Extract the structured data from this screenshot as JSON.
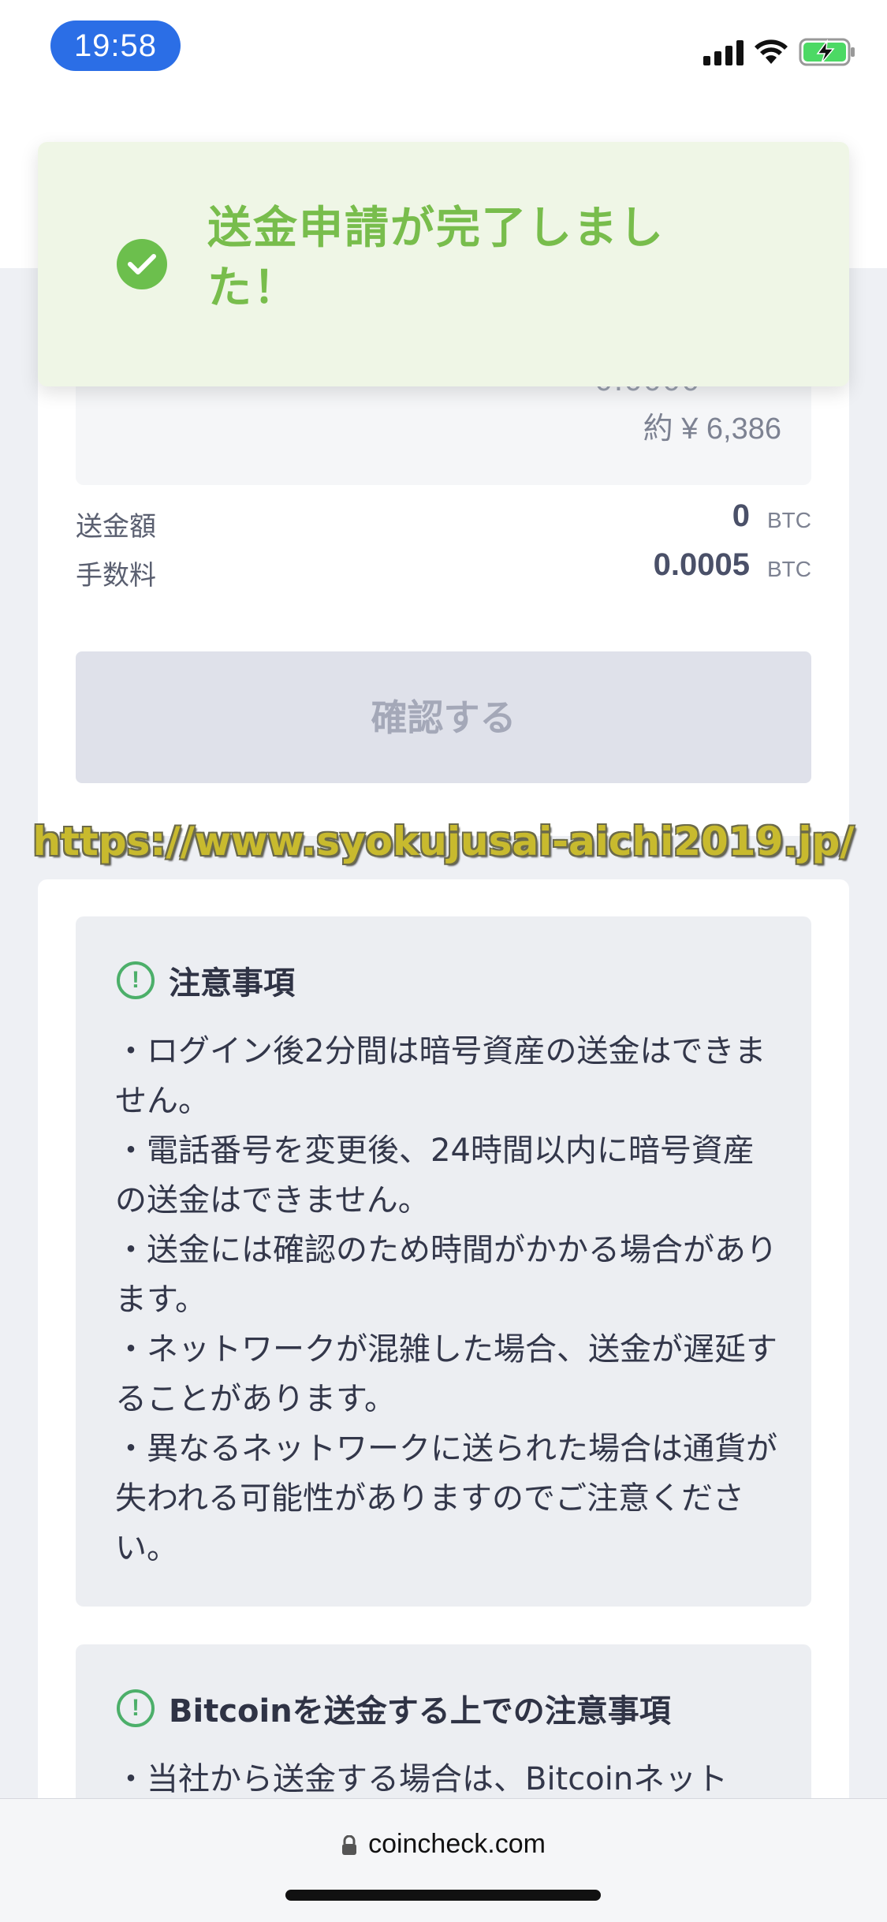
{
  "status_bar": {
    "time": "19:58"
  },
  "header": {
    "back_glyph": "↑"
  },
  "amount": {
    "masked_value": "0.0000",
    "approx_jpy": "約 ¥ 6,386"
  },
  "summary": {
    "send_amount_label": "送金額",
    "send_amount_value": "0",
    "send_amount_unit": "BTC",
    "fee_label": "手数料",
    "fee_value": "0.0005",
    "fee_unit": "BTC"
  },
  "confirm_button_label": "確認する",
  "watermark": "https://www.syokujusai-aichi2019.jp/",
  "notes": {
    "title": "注意事項",
    "items": [
      "・ログイン後2分間は暗号資産の送金はできません。",
      "・電話番号を変更後、24時間以内に暗号資産の送金はできません。",
      "・送金には確認のため時間がかかる場合があります。",
      "・ネットワークが混雑した場合、送金が遅延することがあります。",
      "・異なるネットワークに送られた場合は通貨が失われる可能性がありますのでご注意ください。"
    ]
  },
  "bitcoin_notes": {
    "title": "Bitcoinを送金する上での注意事項",
    "first_line": "・当社から送金する場合は、Bitcoinネット"
  },
  "toast": {
    "message_line1": "送金申請が完了しまし",
    "message_line2": "た！"
  },
  "browser": {
    "url": "coincheck.com"
  },
  "colors": {
    "accent_green": "#78bd4c",
    "toast_bg": "#eff6e6",
    "time_pill": "#2b6ee6",
    "button_disabled": "#dfe1ea"
  }
}
